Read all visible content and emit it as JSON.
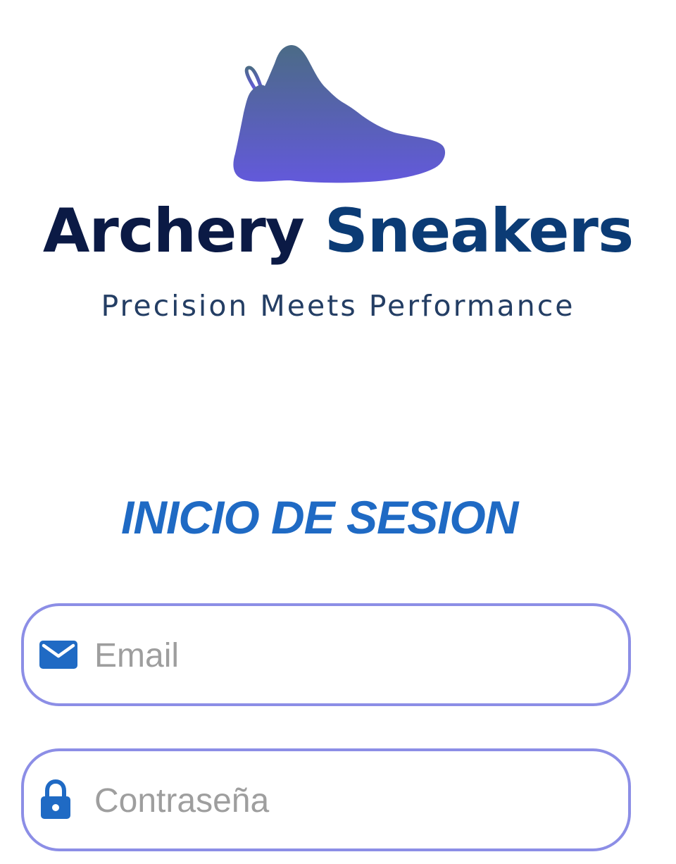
{
  "brand": {
    "name_part1": "Archery",
    "name_part2": "Sneakers",
    "tagline": "Precision Meets Performance",
    "logo_icon": "sneaker-icon"
  },
  "login": {
    "title": "INICIO DE SESION",
    "email": {
      "placeholder": "Email",
      "value": "",
      "icon": "mail-icon"
    },
    "password": {
      "placeholder": "Contraseña",
      "value": "",
      "icon": "lock-icon"
    }
  },
  "colors": {
    "accent": "#1f6ac4",
    "field_border": "#8c8ee6",
    "brand_dark": "#0b1a45",
    "shoe_top": "#4a6a8a",
    "shoe_bottom": "#6358d8"
  }
}
